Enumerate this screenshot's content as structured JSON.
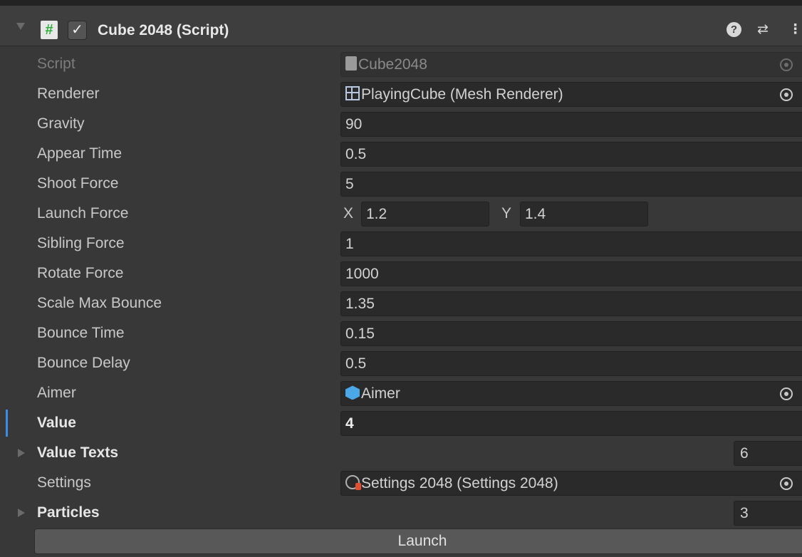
{
  "component": {
    "title": "Cube 2048 (Script)",
    "enabled_glyph": "✓",
    "script_icon_glyph": "#",
    "help_glyph": "?",
    "preset_glyph": "⇄",
    "menu_glyph": "⋮"
  },
  "fields": {
    "script": {
      "label": "Script",
      "value": "Cube2048"
    },
    "renderer": {
      "label": "Renderer",
      "value": "PlayingCube (Mesh Renderer)"
    },
    "gravity": {
      "label": "Gravity",
      "value": "90"
    },
    "appear_time": {
      "label": "Appear Time",
      "value": "0.5"
    },
    "shoot_force": {
      "label": "Shoot Force",
      "value": "5"
    },
    "launch_force": {
      "label": "Launch Force",
      "x_label": "X",
      "x": "1.2",
      "y_label": "Y",
      "y": "1.4"
    },
    "sibling_force": {
      "label": "Sibling Force",
      "value": "1"
    },
    "rotate_force": {
      "label": "Rotate Force",
      "value": "1000"
    },
    "scale_max_bounce": {
      "label": "Scale Max Bounce",
      "value": "1.35"
    },
    "bounce_time": {
      "label": "Bounce Time",
      "value": "0.15"
    },
    "bounce_delay": {
      "label": "Bounce Delay",
      "value": "0.5"
    },
    "aimer": {
      "label": "Aimer",
      "value": "Aimer"
    },
    "value": {
      "label": "Value",
      "value": "4"
    },
    "value_texts": {
      "label": "Value Texts",
      "count": "6"
    },
    "settings": {
      "label": "Settings",
      "value": "Settings 2048 (Settings 2048)"
    },
    "particles": {
      "label": "Particles",
      "count": "3"
    }
  },
  "launch_button": "Launch",
  "colors": {
    "accent": "#3a8ee6",
    "background": "#383838",
    "field": "#2a2a2a"
  }
}
